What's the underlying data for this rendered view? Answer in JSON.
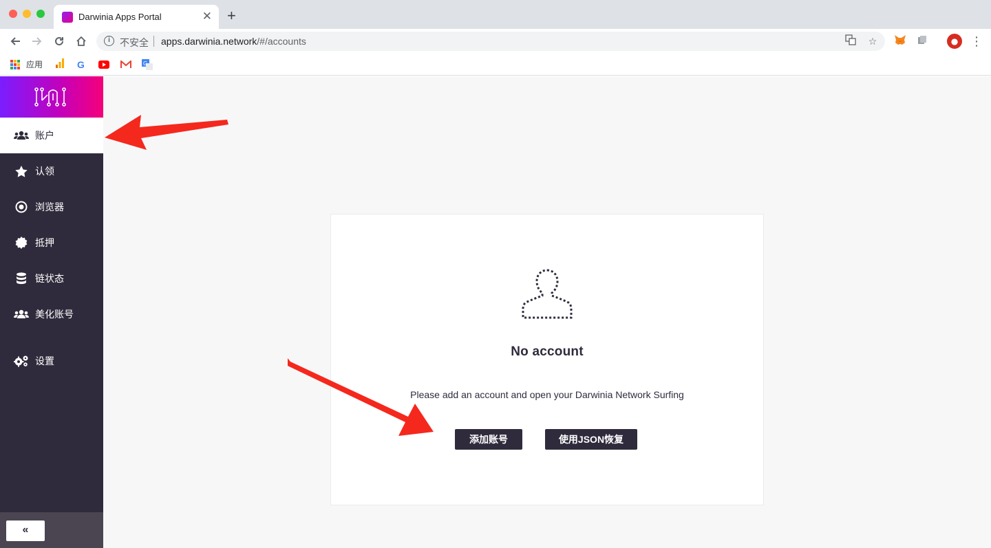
{
  "browser": {
    "tab": {
      "title": "Darwinia Apps Portal",
      "close_glyph": "✕"
    },
    "new_tab_glyph": "+",
    "address": {
      "security_label": "不安全",
      "host": "apps.darwinia.network",
      "path": "/#/accounts"
    },
    "bookmarks": [
      {
        "label": "应用",
        "icon": "apps-grid-icon"
      },
      {
        "label": "",
        "icon": "analytics-icon"
      },
      {
        "label": "",
        "icon": "google-icon"
      },
      {
        "label": "",
        "icon": "youtube-icon"
      },
      {
        "label": "",
        "icon": "gmail-icon"
      },
      {
        "label": "",
        "icon": "translate-icon"
      }
    ]
  },
  "sidebar": {
    "logo": "darwinia-logo",
    "items": [
      {
        "label": "账户",
        "icon": "users-icon",
        "active": true
      },
      {
        "label": "认领",
        "icon": "star-icon",
        "active": false
      },
      {
        "label": "浏览器",
        "icon": "target-icon",
        "active": false
      },
      {
        "label": "抵押",
        "icon": "badge-icon",
        "active": false
      },
      {
        "label": "链状态",
        "icon": "database-icon",
        "active": false
      },
      {
        "label": "美化账号",
        "icon": "users-icon",
        "active": false
      },
      {
        "label": "设置",
        "icon": "gears-icon",
        "active": false
      }
    ],
    "collapse_glyph": "«"
  },
  "main": {
    "empty_state": {
      "icon": "user-outline-icon",
      "title": "No account",
      "description": "Please add an account and open your Darwinia Network Surfing",
      "add_button": "添加账号",
      "restore_button": "使用JSON恢复"
    }
  },
  "colors": {
    "sidebar_bg": "#302b3c",
    "logo_gradient_start": "#7b1dff",
    "logo_gradient_end": "#f5007a",
    "button_bg": "#302b3c",
    "annotation_arrow": "#f5281d"
  }
}
